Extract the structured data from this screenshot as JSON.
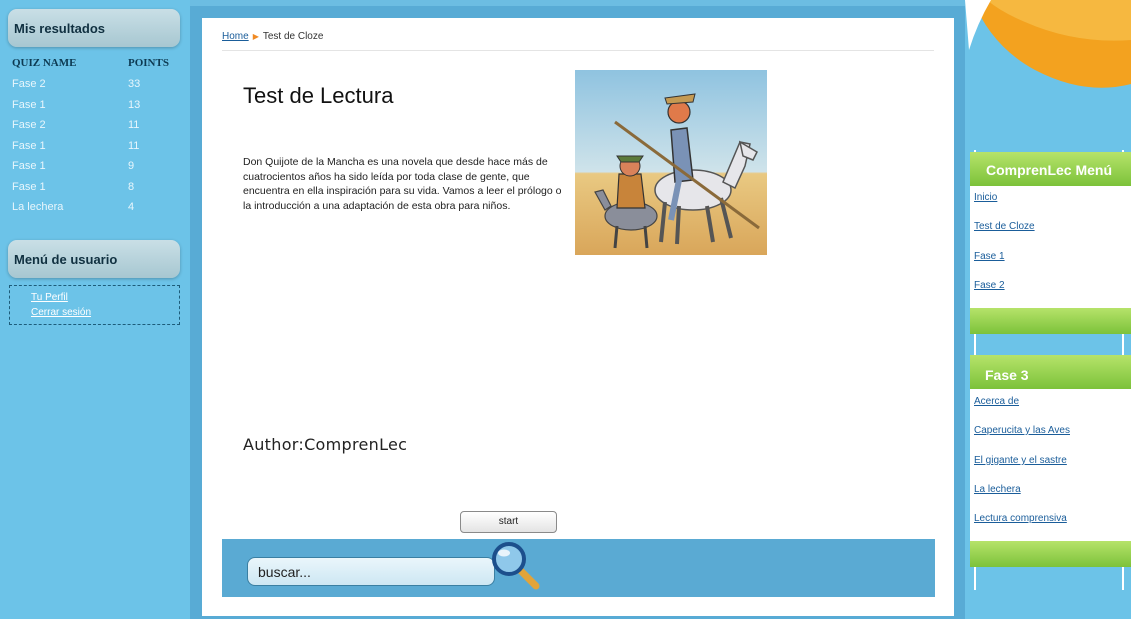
{
  "sidebar": {
    "results_title": "Mis resultados",
    "results_headers": {
      "name": "QUIZ NAME",
      "points": "POINTS"
    },
    "results": [
      {
        "name": "Fase 2",
        "points": "33"
      },
      {
        "name": "Fase 1",
        "points": "13"
      },
      {
        "name": "Fase 2",
        "points": "11"
      },
      {
        "name": "Fase 1",
        "points": "11"
      },
      {
        "name": "Fase 1",
        "points": "9"
      },
      {
        "name": "Fase 1",
        "points": "8"
      },
      {
        "name": "La lechera",
        "points": "4"
      }
    ],
    "user_menu_title": "Menú de usuario",
    "user_menu": [
      {
        "label": "Tu Perfil"
      },
      {
        "label": "Cerrar sesión"
      }
    ]
  },
  "main": {
    "breadcrumb": {
      "home": "Home",
      "current": "Test de Cloze"
    },
    "title": "Test de Lectura",
    "intro": "Don Quijote de la Mancha es una novela que desde hace más de cuatrocientos años ha sido leída por toda clase de gente, que encuentra en ella inspiración para su vida. Vamos a leer el prólogo o la introducción a una adaptación de esta obra para niños.",
    "author": "Author:ComprenLec",
    "start_label": "start",
    "search_placeholder": "buscar..."
  },
  "right": {
    "menu_title": "ComprenLec Menú",
    "menu": [
      {
        "label": "Inicio"
      },
      {
        "label": "Test de Cloze"
      },
      {
        "label": "Fase 1"
      },
      {
        "label": "Fase 2"
      }
    ],
    "fase3_title": "Fase 3",
    "fase3": [
      {
        "label": "Acerca de"
      },
      {
        "label": "Caperucita y las Aves"
      },
      {
        "label": "El gigante y el sastre"
      },
      {
        "label": "La lechera"
      },
      {
        "label": "Lectura comprensiva"
      }
    ]
  },
  "colors": {
    "background": "#6cbde2",
    "accent_green": "#8fd04a",
    "link_blue": "#1a5d9a"
  }
}
